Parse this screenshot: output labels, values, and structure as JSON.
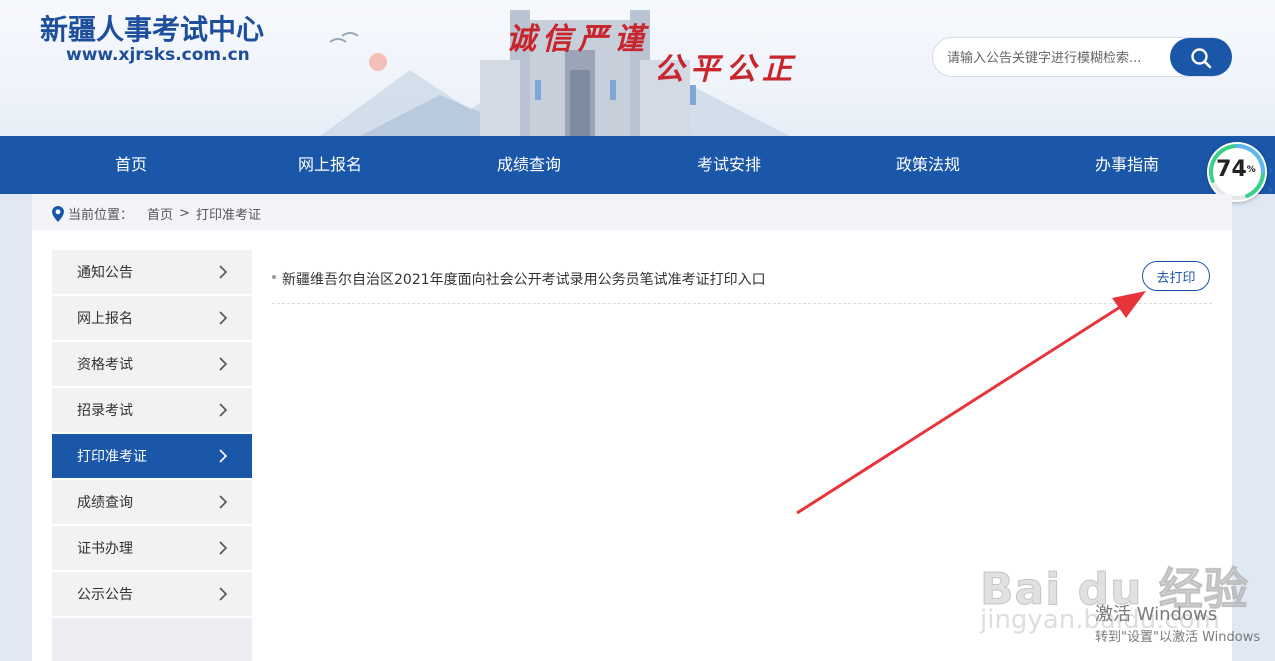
{
  "header": {
    "title": "新疆人事考试中心",
    "url": "www.xjrsks.com.cn",
    "slogan_left": "诚信严谨",
    "slogan_right": "公平公正"
  },
  "search": {
    "placeholder": "请输入公告关键字进行模糊检索..."
  },
  "nav": {
    "items": [
      {
        "label": "首页"
      },
      {
        "label": "网上报名"
      },
      {
        "label": "成绩查询"
      },
      {
        "label": "考试安排"
      },
      {
        "label": "政策法规"
      },
      {
        "label": "办事指南"
      }
    ]
  },
  "progress": {
    "value": 74,
    "unit": "%"
  },
  "breadcrumb": {
    "prefix": "当前位置：",
    "home": "首页",
    "separator": ">",
    "current": "打印准考证"
  },
  "sidebar": {
    "items": [
      {
        "label": "通知公告"
      },
      {
        "label": "网上报名"
      },
      {
        "label": "资格考试"
      },
      {
        "label": "招录考试"
      },
      {
        "label": "打印准考证",
        "active": true
      },
      {
        "label": "成绩查询"
      },
      {
        "label": "证书办理"
      },
      {
        "label": "公示公告"
      }
    ]
  },
  "list": {
    "items": [
      {
        "title": "新疆维吾尔自治区2021年度面向社会公开考试录用公务员笔试准考证打印入口",
        "action": "去打印"
      }
    ]
  },
  "watermark": {
    "brand": "Bai du 经验",
    "url": "jingyan.baidu.com"
  },
  "os_notice": {
    "line1": "激活 Windows",
    "line2": "转到\"设置\"以激活 Windows"
  },
  "colors": {
    "brand_blue": "#1b57a8",
    "slogan_red": "#c8252d",
    "annotation_red": "#e8353b"
  }
}
